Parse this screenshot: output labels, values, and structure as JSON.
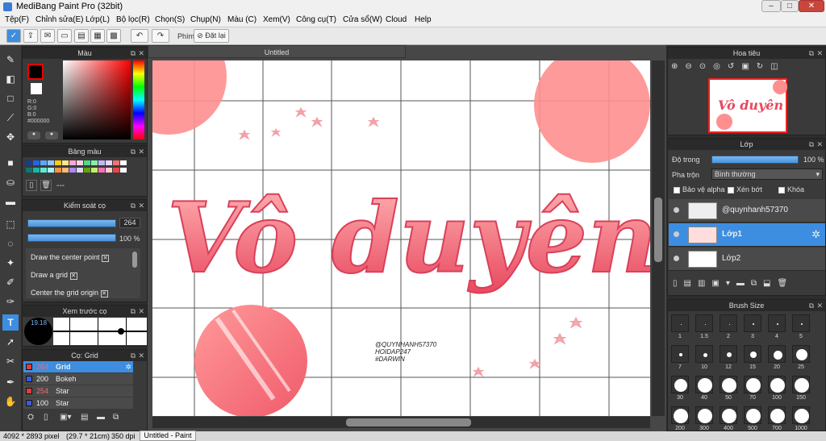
{
  "window": {
    "title": "MediBang Paint Pro (32bit)",
    "min": "–",
    "max": "□",
    "close": "✕"
  },
  "menu": [
    "Tệp(F)",
    "Chỉnh sửa(E)",
    "Lớp(L)",
    "Bộ lọc(R)",
    "Chọn(S)",
    "Chụp(N)",
    "Màu (C)",
    "Xem(V)",
    "Công cụ(T)",
    "Cửa sổ(W)",
    "Cloud",
    "Help"
  ],
  "toolbar": {
    "phim_label": "Phím",
    "reset_label": "Đặt lại"
  },
  "color_panel": {
    "title": "Màu",
    "r": "R:0",
    "g": "G:0",
    "b": "B:0",
    "hex": "#000000"
  },
  "palette_panel": {
    "title": "Bảng màu",
    "dash": "---"
  },
  "brush_control": {
    "title": "Kiểm soát cọ",
    "size_value": "264",
    "opacity_value": "100 %",
    "options": [
      {
        "label": "Draw the center point",
        "checked": true
      },
      {
        "label": "Draw a grid",
        "checked": true
      },
      {
        "label": "Center the grid origin",
        "checked": true
      }
    ]
  },
  "brush_preview": {
    "title": "Xem trước cọ",
    "size": "19.18"
  },
  "brush_list": {
    "title": "Cọ: Grid",
    "items": [
      {
        "size": "264",
        "name": "Grid",
        "color": "#e23c3c",
        "selected": true
      },
      {
        "size": "200",
        "name": "Bokeh",
        "color": "#3a5cd8",
        "selected": false
      },
      {
        "size": "254",
        "name": "Star",
        "color": "#e23c3c",
        "selected": false
      },
      {
        "size": "100",
        "name": "Star",
        "color": "#3a5cd8",
        "selected": false
      }
    ]
  },
  "document": {
    "tab": "Untitled",
    "watermark": "@QUYNHANH57370\nHOIDAP247\n#DARWIN",
    "title_text": "Vô duyên"
  },
  "navigator": {
    "title": "Hoa tiêu"
  },
  "layers_panel": {
    "title": "Lớp",
    "opacity_label": "Độ trong",
    "opacity_value": "100 %",
    "blend_label": "Pha trộn",
    "blend_value": "Bình thường",
    "protect_alpha": "Bảo vệ alpha",
    "clip": "Xén bớt",
    "lock": "Khóa",
    "layers": [
      {
        "name": "@quynhanh57370",
        "selected": false
      },
      {
        "name": "Lớp1",
        "selected": true
      },
      {
        "name": "Lớp2",
        "selected": false
      }
    ]
  },
  "brush_size_panel": {
    "title": "Brush Size",
    "rows": [
      [
        "1",
        "1.5",
        "2",
        "3",
        "4",
        "5"
      ],
      [
        "7",
        "10",
        "12",
        "15",
        "20",
        "25"
      ],
      [
        "30",
        "40",
        "50",
        "70",
        "100",
        "150"
      ],
      [
        "200",
        "300",
        "400",
        "500",
        "700",
        "1000"
      ]
    ]
  },
  "status": {
    "size": "4092 * 2893 pixel",
    "cm": "(29.7 * 21cm)",
    "dpi": "350 dpi",
    "taskbar": "Untitled - Paint"
  }
}
